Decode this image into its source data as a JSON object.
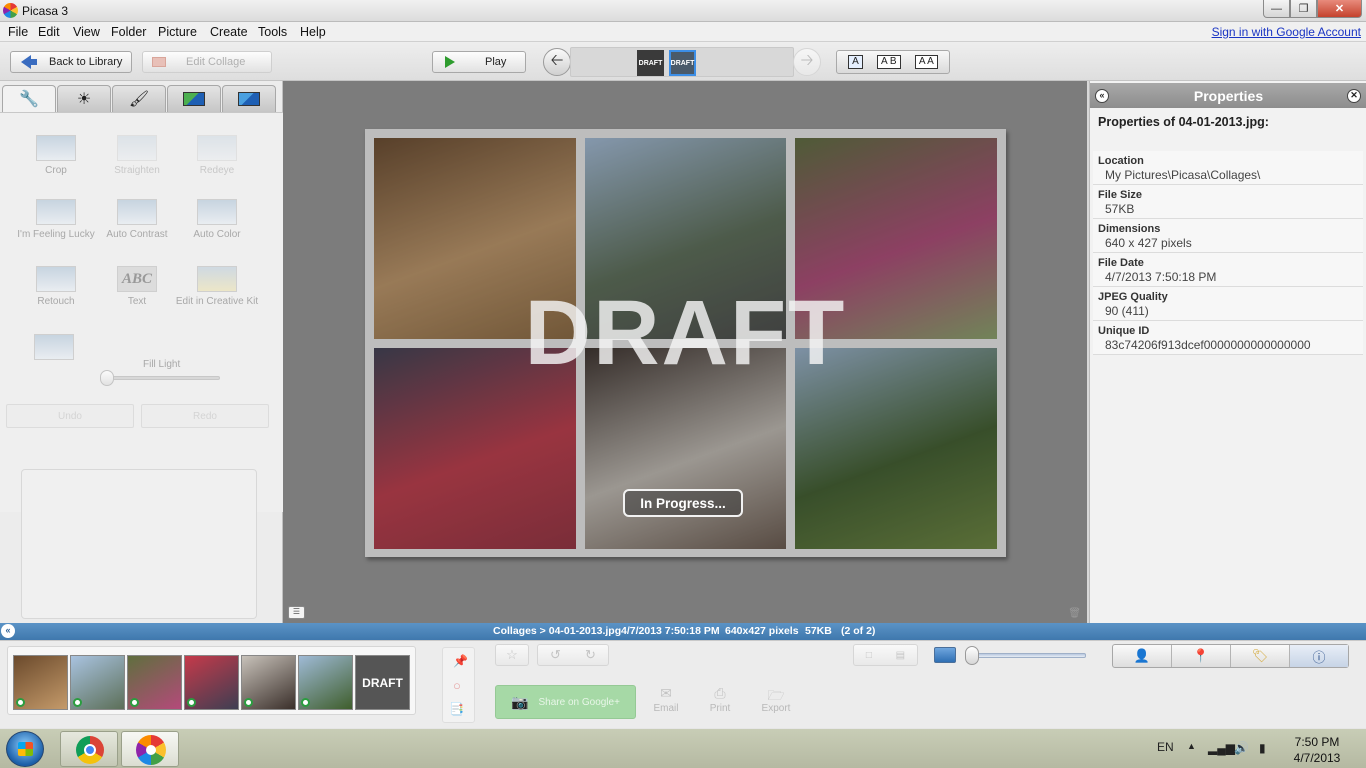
{
  "window": {
    "title": "Picasa 3"
  },
  "menu": {
    "items": [
      "File",
      "Edit",
      "View",
      "Folder",
      "Picture",
      "Create",
      "Tools",
      "Help"
    ],
    "signin": "Sign in with Google Account"
  },
  "toolbar": {
    "back_label": "Back to Library",
    "edit_collage_label": "Edit Collage",
    "play_label": "Play",
    "filmstrip": [
      {
        "label": "DRAFT"
      },
      {
        "label": "DRAFT"
      }
    ],
    "view_modes": [
      "A",
      "A B",
      "A A"
    ]
  },
  "edit_tools": {
    "row1": [
      "Crop",
      "Straighten",
      "Redeye"
    ],
    "row2": [
      "I'm Feeling Lucky",
      "Auto Contrast",
      "Auto Color"
    ],
    "row3": [
      "Retouch",
      "Text",
      "Edit in Creative Kit"
    ],
    "text_icon_label": "ABC",
    "fill_light_label": "Fill Light",
    "fill_light_value": 0,
    "undo_label": "Undo",
    "redo_label": "Redo"
  },
  "viewer": {
    "watermark": "DRAFT",
    "status_button": "In Progress...",
    "photos": [
      {
        "colors": [
          "#6b4a2c",
          "#c49a6a",
          "#8e6a3f"
        ]
      },
      {
        "colors": [
          "#a9c3e0",
          "#5c6f58",
          "#4a4a4a"
        ]
      },
      {
        "colors": [
          "#5f6f3e",
          "#b44a7a",
          "#8ea86c"
        ]
      },
      {
        "colors": [
          "#3e3e52",
          "#c53a4a",
          "#9a3040"
        ]
      },
      {
        "colors": [
          "#3a2f2a",
          "#c8c2ba",
          "#6b5a4e"
        ]
      },
      {
        "colors": [
          "#9fbad6",
          "#3f5e2c",
          "#6e8a3e"
        ]
      }
    ]
  },
  "properties": {
    "title": "Properties",
    "subtitle": "Properties of 04-01-2013.jpg:",
    "fields": [
      {
        "key": "Location",
        "value": "My Pictures\\Picasa\\Collages\\"
      },
      {
        "key": "File Size",
        "value": "57KB"
      },
      {
        "key": "Dimensions",
        "value": "640 x 427 pixels"
      },
      {
        "key": "File Date",
        "value": "4/7/2013 7:50:18 PM"
      },
      {
        "key": "JPEG Quality",
        "value": "90 (411)"
      },
      {
        "key": "Unique ID",
        "value": "83c74206f913dcef0000000000000000"
      }
    ]
  },
  "statusbar": {
    "path": "Collages > 04-01-2013.jpg",
    "date": "4/7/2013 7:50:18 PM",
    "dims": "640x427 pixels",
    "size": "57KB",
    "count": "(2 of 2)"
  },
  "tray": {
    "thumbnails": [
      {
        "colors": [
          "#6b4a2c",
          "#c49a6a"
        ]
      },
      {
        "colors": [
          "#a9c3e0",
          "#5c6f58"
        ]
      },
      {
        "colors": [
          "#5f6f3e",
          "#b44a7a"
        ]
      },
      {
        "colors": [
          "#c53a4a",
          "#3e3e52"
        ]
      },
      {
        "colors": [
          "#c8c2ba",
          "#3a2f2a"
        ]
      },
      {
        "colors": [
          "#9fbad6",
          "#3f5e2c"
        ]
      }
    ],
    "draft_thumb_label": "DRAFT",
    "share_label": "Share on Google+",
    "actions": [
      "Email",
      "Print",
      "Export"
    ]
  },
  "taskbar": {
    "language": "EN",
    "time": "7:50 PM",
    "date": "4/7/2013"
  }
}
